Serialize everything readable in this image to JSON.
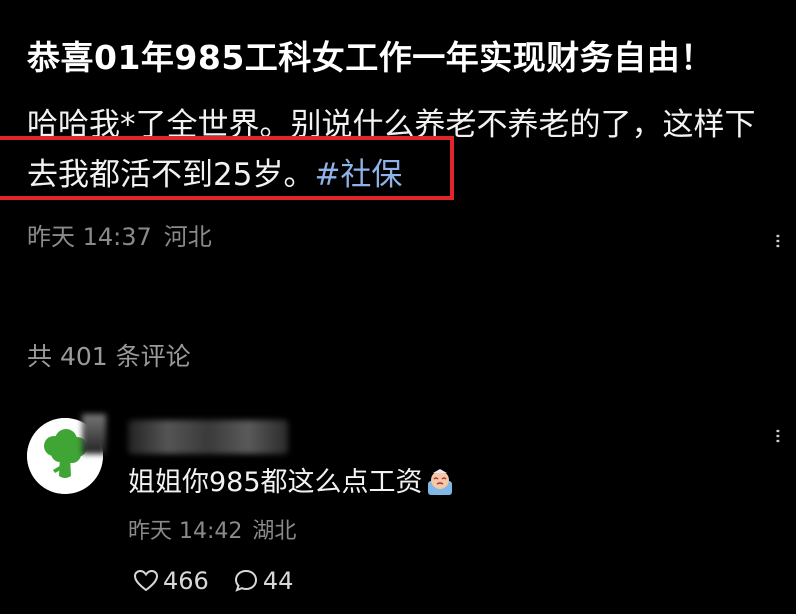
{
  "post": {
    "title": "恭喜01年985工科女工作一年实现财务自由！",
    "body_line1": "哈哈我*了全世界。别说什么养老不养老的了，这样下",
    "body_line2": "去我都活不到25岁。",
    "hashtag": "#社保",
    "time": "昨天 14:37",
    "location": "河北",
    "more_icon": "more-vertical-icon"
  },
  "comments_header": {
    "label": "共 401 条评论"
  },
  "comment": {
    "avatar_icon": "broccoli-icon",
    "text": "姐姐你985都这么点工资",
    "emoji_icon": "crying-face-icon",
    "time": "昨天 14:42",
    "location": "湖北",
    "likes": "466",
    "replies": "44",
    "like_icon": "heart-icon",
    "reply_icon": "comment-bubble-icon"
  },
  "colors": {
    "background": "#000000",
    "highlight_border": "#e0262b",
    "hashtag": "#8fb3e8",
    "meta_text": "#8a8a8a",
    "avatar_green": "#3fa535"
  }
}
